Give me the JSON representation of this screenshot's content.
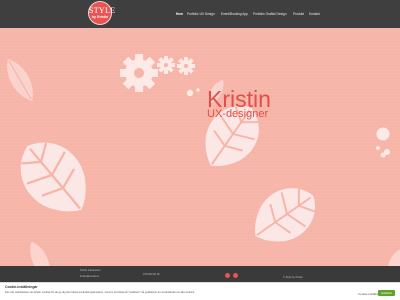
{
  "logo": {
    "line1": "STYLE",
    "line2": "by Kristin"
  },
  "nav": {
    "items": [
      {
        "label": "Hem",
        "active": true
      },
      {
        "label": "Portfolio UX Design",
        "active": false
      },
      {
        "label": "Event/Booking App",
        "active": false
      },
      {
        "label": "Portfolio Grafisk Design",
        "active": false
      },
      {
        "label": "Produkt",
        "active": false
      },
      {
        "label": "Kontakt",
        "active": false
      }
    ]
  },
  "hero": {
    "title": "Kristin",
    "subtitle": "UX-designer"
  },
  "footer": {
    "col1": [
      "Kristin Johansson",
      "kristin@email.se"
    ],
    "col2": "070-000 00 00",
    "col3": "© Style by Kristin"
  },
  "cookie": {
    "title": "Cookie-inställningar",
    "body": "Den här webbplatsen använder cookies för att ge dig den bästa användarupplevelsen. Genom att klicka på \"Godkänn\" så godkänner du användandet av alla cookies.",
    "settings_label": "Cookie-inställningar",
    "accept_label": "Godkänn"
  },
  "colors": {
    "accent": "#e34e48",
    "hero_bg": "#f7b4a8",
    "header_bg": "#3f3f3f",
    "accept_btn": "#61a229"
  }
}
